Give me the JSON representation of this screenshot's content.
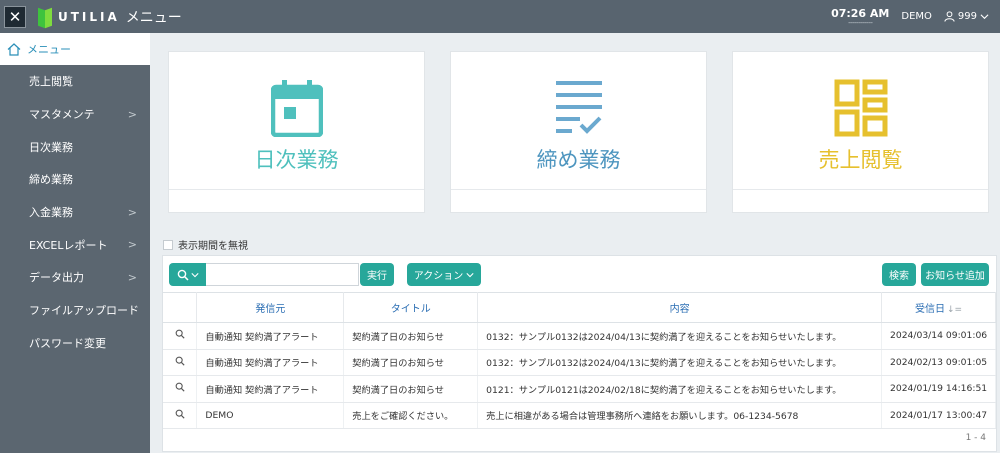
{
  "header": {
    "logo_text": "UTILIA",
    "title": "メニュー",
    "time": "07:26 AM",
    "time_sub": "------------",
    "company": "DEMO",
    "user": "999"
  },
  "sidebar": {
    "header": "メニュー",
    "items": [
      {
        "label": "売上閲覧",
        "has_children": false
      },
      {
        "label": "マスタメンテ",
        "has_children": true
      },
      {
        "label": "日次業務",
        "has_children": false
      },
      {
        "label": "締め業務",
        "has_children": false
      },
      {
        "label": "入金業務",
        "has_children": true
      },
      {
        "label": "EXCELレポート",
        "has_children": true
      },
      {
        "label": "データ出力",
        "has_children": true
      },
      {
        "label": "ファイルアップロード",
        "has_children": false
      },
      {
        "label": "パスワード変更",
        "has_children": false
      }
    ]
  },
  "cards": [
    {
      "label": "日次業務",
      "icon": "calendar-icon",
      "color": "#4fc0bd"
    },
    {
      "label": "締め業務",
      "icon": "checklist-icon",
      "color": "#4d95bf"
    },
    {
      "label": "売上閲覧",
      "icon": "dashboard-icon",
      "color": "#e6c02e"
    }
  ],
  "notices": {
    "ignore_period_label": "表示期間を無視",
    "search_placeholder": "",
    "run_label": "実行",
    "action_label": "アクション",
    "search_label": "検索",
    "add_label": "お知らせ追加",
    "columns": [
      "発信元",
      "タイトル",
      "内容",
      "受信日"
    ],
    "rows": [
      {
        "sender": "自動通知 契約満了アラート",
        "title": "契約満了日のお知らせ",
        "content": "0132：サンプル0132は2024/04/13に契約満了を迎えることをお知らせいたします。",
        "date": "2024/03/14 09:01:06"
      },
      {
        "sender": "自動通知 契約満了アラート",
        "title": "契約満了日のお知らせ",
        "content": "0132：サンプル0132は2024/04/13に契約満了を迎えることをお知らせいたします。",
        "date": "2024/02/13 09:01:05"
      },
      {
        "sender": "自動通知 契約満了アラート",
        "title": "契約満了日のお知らせ",
        "content": "0121：サンプル0121は2024/02/18に契約満了を迎えることをお知らせいたします。",
        "date": "2024/01/19 14:16:51"
      },
      {
        "sender": "DEMO",
        "title": "売上をご確認ください。",
        "content": "売上に相違がある場合は管理事務所へ連絡をお願いします。06-1234-5678",
        "date": "2024/01/17 13:00:47"
      }
    ],
    "pager": "1 - 4"
  }
}
